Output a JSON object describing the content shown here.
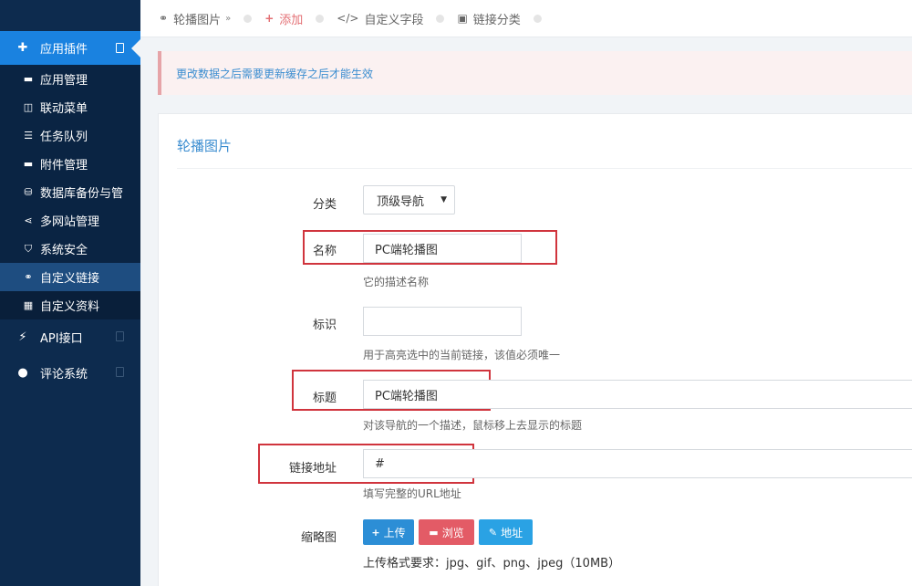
{
  "sidebar": {
    "group_app": "应用插件",
    "items": [
      {
        "label": "应用管理",
        "icon": "folder-icon",
        "glyph": "▬"
      },
      {
        "label": "联动菜单",
        "icon": "columns-icon",
        "glyph": "◫"
      },
      {
        "label": "任务队列",
        "icon": "list-icon",
        "glyph": "☰"
      },
      {
        "label": "附件管理",
        "icon": "folder-icon",
        "glyph": "▬"
      },
      {
        "label": "数据库备份与管",
        "icon": "database-icon",
        "glyph": "⛁"
      },
      {
        "label": "多网站管理",
        "icon": "share-icon",
        "glyph": "⋖"
      },
      {
        "label": "系统安全",
        "icon": "shield-icon",
        "glyph": "⛉"
      },
      {
        "label": "自定义链接",
        "icon": "link-icon",
        "glyph": "⚭"
      },
      {
        "label": "自定义资料",
        "icon": "grid-icon",
        "glyph": "▦"
      }
    ],
    "group_api": "API接口",
    "group_comment": "评论系统"
  },
  "tabs": {
    "carousel": "轮播图片",
    "add": "添加",
    "custom_field": "自定义字段",
    "link_category": "链接分类"
  },
  "notice": "更改数据之后需要更新缓存之后才能生效",
  "panel": {
    "title": "轮播图片",
    "category_label": "分类",
    "category_value": "顶级导航",
    "name_label": "名称",
    "name_value": "PC端轮播图",
    "name_help": "它的描述名称",
    "id_label": "标识",
    "id_value": "",
    "id_help": "用于高亮选中的当前链接，该值必须唯一",
    "title_label": "标题",
    "title_value": "PC端轮播图",
    "title_help": "对该导航的一个描述，鼠标移上去显示的标题",
    "url_label": "链接地址",
    "url_value": "#",
    "url_help": "填写完整的URL地址",
    "thumb_label": "缩略图",
    "upload_btn": "上传",
    "browse_btn": "浏览",
    "address_btn": "地址",
    "upload_help": "上传格式要求：jpg、gif、png、jpeg（10MB）"
  },
  "colors": {
    "sidebar_bg": "#0d2b4e",
    "active_blue": "#1a82e0",
    "accent_link": "#3b8dd0",
    "highlight_red": "#d0343d"
  }
}
